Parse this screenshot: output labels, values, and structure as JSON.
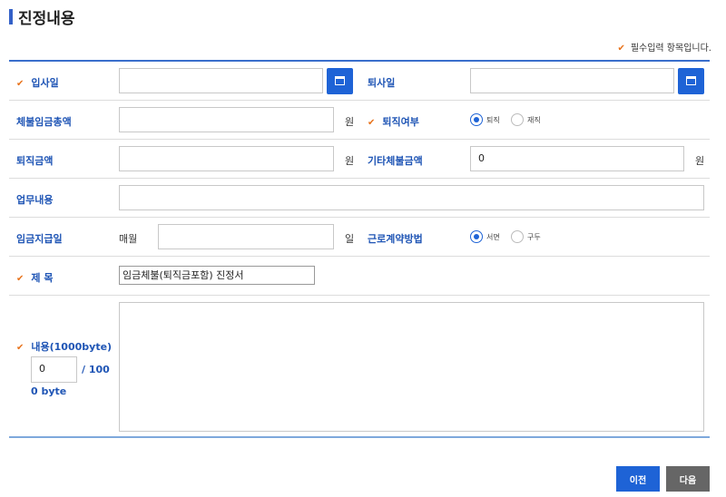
{
  "section": {
    "title": "진정내용"
  },
  "required_note": "필수입력 항목입니다.",
  "form": {
    "hire_date": {
      "label": "입사일",
      "value": ""
    },
    "leave_date": {
      "label": "퇴사일",
      "value": ""
    },
    "unpaid_total": {
      "label": "체불임금총액",
      "value": "",
      "unit": "원"
    },
    "resigned": {
      "label": "퇴직여부",
      "options": [
        "퇴직",
        "재직"
      ],
      "selected": "퇴직"
    },
    "severance": {
      "label": "퇴직금액",
      "value": "",
      "unit": "원"
    },
    "other_unpaid": {
      "label": "기타체불금액",
      "value": "0",
      "unit": "원"
    },
    "job_desc": {
      "label": "업무내용",
      "value": ""
    },
    "pay_day": {
      "label": "임금지급일",
      "prefix": "매월",
      "value": "",
      "unit": "일"
    },
    "contract_method": {
      "label": "근로계약방법",
      "options": [
        "서면",
        "구두"
      ],
      "selected": "서면"
    },
    "subject": {
      "label": "제 목",
      "value": "임금체불(퇴직금포함) 진정서"
    },
    "content": {
      "label": "내용(1000byte)",
      "byte_count": "0",
      "byte_limit_a": "/ 100",
      "byte_limit_b": "0 byte",
      "value": ""
    }
  },
  "buttons": {
    "prev": "이전",
    "next": "다음"
  },
  "colors": {
    "accent": "#1e63d6",
    "label": "#1f55b5",
    "required": "#e8731c"
  }
}
